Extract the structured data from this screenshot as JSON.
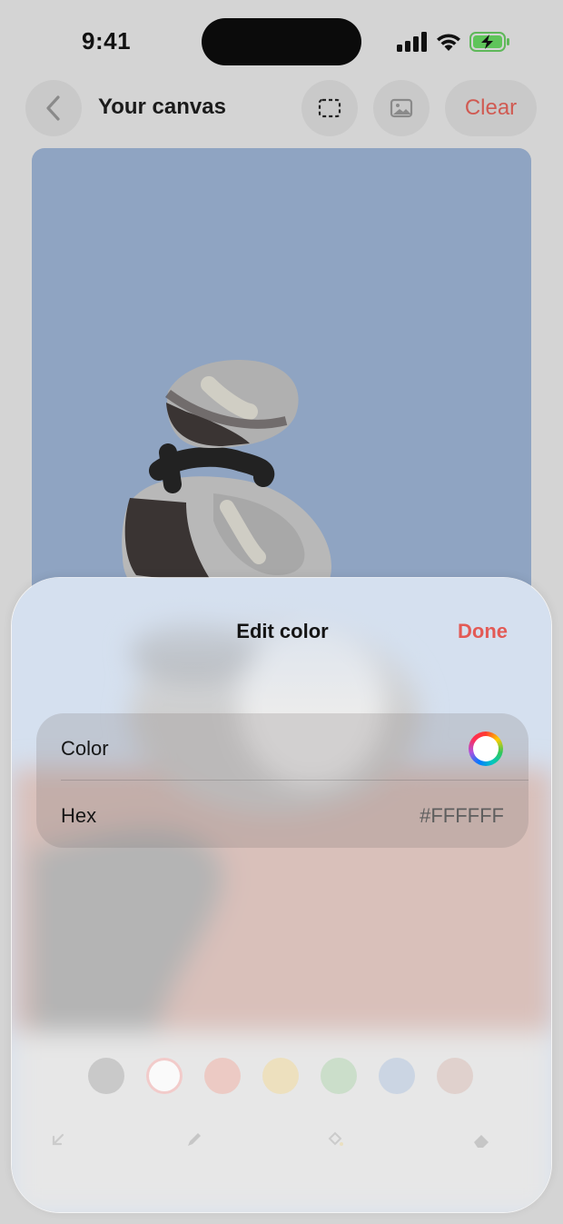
{
  "status_bar": {
    "time": "9:41"
  },
  "nav": {
    "title": "Your canvas",
    "clear_label": "Clear"
  },
  "sheet": {
    "title": "Edit color",
    "done_label": "Done",
    "color_row": {
      "label": "Color"
    },
    "hex_row": {
      "label": "Hex",
      "value": "#FFFFFF"
    }
  },
  "palette": {
    "swatches": [
      "#a3a3a3",
      "#ffffff",
      "#f2a79a",
      "#f4d88b",
      "#a9d2a6",
      "#a9bedd",
      "#d6b5ac"
    ],
    "selected_swatch": "#ffffff"
  },
  "colors": {
    "accent": "#E35A55",
    "canvas_sky": "#8FA4C2",
    "canvas_ground": "#D8B3AB"
  }
}
